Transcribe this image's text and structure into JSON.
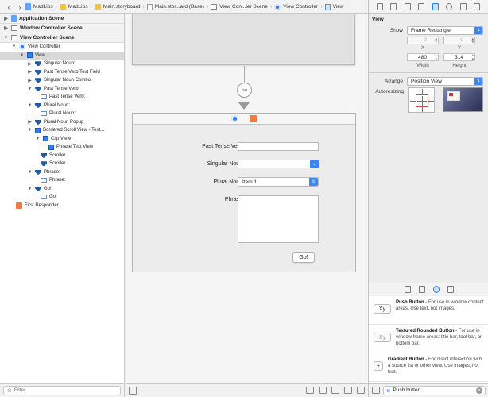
{
  "jumpbar": {
    "back": "‹",
    "forward": "›",
    "items": [
      "MadLibs",
      "MadLibs",
      "Main.storyboard",
      "Main.stor...ard (Base)",
      "View Con...ler Scene",
      "View Controller",
      "View"
    ]
  },
  "navigator": {
    "scenes": [
      {
        "label": "Application Scene"
      },
      {
        "label": "Window Controller Scene"
      },
      {
        "label": "View Controller Scene"
      }
    ],
    "tree": [
      {
        "label": "View Controller"
      },
      {
        "label": "View"
      },
      {
        "label": "Singular Noun:"
      },
      {
        "label": "Past Tense Verb Text Field"
      },
      {
        "label": "Singular Noun Combo"
      },
      {
        "label": "Past Tense Verb:"
      },
      {
        "label": "Past Tense Verb:"
      },
      {
        "label": "Plural Noun:"
      },
      {
        "label": "Plural Noun:"
      },
      {
        "label": "Plural Noun Popup"
      },
      {
        "label": "Bordered Scroll View - Text..."
      },
      {
        "label": "Clip View"
      },
      {
        "label": "Phrase Text View"
      },
      {
        "label": "Scroller"
      },
      {
        "label": "Scroller"
      },
      {
        "label": "Phrase:"
      },
      {
        "label": "Phrase:"
      },
      {
        "label": "Go!"
      },
      {
        "label": "Go!"
      },
      {
        "label": "First Responder"
      }
    ],
    "filter_placeholder": "Filter"
  },
  "form": {
    "past_tense_label": "Past Tense Verb:",
    "singular_noun_label": "Singular Noun:",
    "plural_noun_label": "Plural Noun:",
    "plural_noun_value": "Item 1",
    "phrase_label": "Phrase:",
    "go_label": "Go!"
  },
  "inspector": {
    "section_title": "View",
    "show_label": "Show",
    "show_value": "Frame Rectangle",
    "x_value": "0",
    "y_value": "0",
    "x_label": "X",
    "y_label": "Y",
    "width_value": "480",
    "height_value": "314",
    "width_label": "Width",
    "height_label": "Height",
    "arrange_label": "Arrange",
    "arrange_value": "Position View",
    "autoresizing_label": "Autoresizing"
  },
  "library": {
    "items": [
      {
        "icon_text": "Xy",
        "name": "Push Button",
        "desc": " - For use in window content areas. Use text, not images."
      },
      {
        "icon_text": "Xy",
        "name": "Textured Rounded Button",
        "desc": " - For use in window frame areas: title bar, tool bar, or bottom bar."
      },
      {
        "icon_text": "+",
        "name": "Gradient Button",
        "desc": " - For direct interaction with a source list or other view. Use images, not text."
      }
    ],
    "search_value": "Push button"
  },
  "colors": {
    "accent": "#2f7df6",
    "first_responder": "#f07b3f"
  }
}
